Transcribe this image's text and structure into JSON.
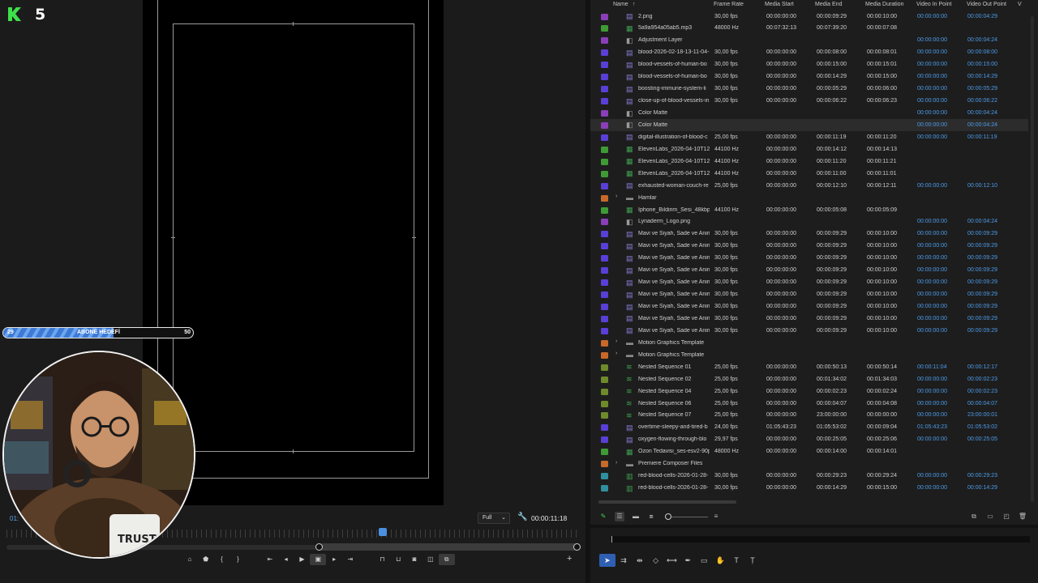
{
  "monitor": {
    "timecode_left": "01:",
    "zoom": "Full",
    "timecode_right": "00:00:11:18",
    "transport": [
      "export-frame-icon",
      "marker-icon",
      "mark-in-icon",
      "mark-out-icon",
      "go-to-in-icon",
      "step-back-icon",
      "play-icon",
      "safe-margins-icon",
      "step-forward-icon",
      "go-to-out-icon",
      "insert-icon",
      "overwrite-icon",
      "camera-icon",
      "compare-icon",
      "proxy-icon"
    ]
  },
  "overlay": {
    "logo_number": "5",
    "goal": {
      "current": "29",
      "label": "ABONE HEDEFİ",
      "target": "50",
      "progress": 0.58
    }
  },
  "project": {
    "columns": {
      "name": "Name",
      "frame_rate": "Frame Rate",
      "media_start": "Media Start",
      "media_end": "Media End",
      "media_duration": "Media Duration",
      "video_in": "Video In Point",
      "video_out": "Video Out Point",
      "extra": "V"
    },
    "label_colors": {
      "purple": "#8a3fb8",
      "violet": "#5a3fd6",
      "green": "#3f9a35",
      "orange": "#c8692a",
      "teal": "#2f8f9f",
      "olive": "#6e8a2a"
    },
    "rows": [
      {
        "label": "purple",
        "icon": "video",
        "name": "2.png",
        "fr": "30,00 fps",
        "ms": "00:00:00:00",
        "me": "00:00:09:29",
        "md": "00:00:10:00",
        "vi": "00:00:00:00",
        "vo": "00:00:04:29"
      },
      {
        "label": "green",
        "icon": "audio",
        "name": "5a9a954a05ab5.mp3",
        "fr": "48000 Hz",
        "ms": "00:07:32:13",
        "me": "00:07:39:20",
        "md": "00:00:07:08",
        "vi": "",
        "vo": ""
      },
      {
        "label": "purple",
        "icon": "adjustment",
        "name": "Adjustment Layer",
        "fr": "",
        "ms": "",
        "me": "",
        "md": "",
        "vi": "00:00:00:00",
        "vo": "00:00:04:24"
      },
      {
        "label": "violet",
        "icon": "video",
        "name": "blood-2026-02-18-13-11-04-",
        "fr": "30,00 fps",
        "ms": "00:00:00:00",
        "me": "00:00:08:00",
        "md": "00:00:08:01",
        "vi": "00:00:00:00",
        "vo": "00:00:08:00"
      },
      {
        "label": "violet",
        "icon": "video",
        "name": "blood-vessels-of-human-bo",
        "fr": "30,00 fps",
        "ms": "00:00:00:00",
        "me": "00:00:15:00",
        "md": "00:00:15:01",
        "vi": "00:00:00:00",
        "vo": "00:00:15:00"
      },
      {
        "label": "violet",
        "icon": "video",
        "name": "blood-vessels-of-human-bo",
        "fr": "30,00 fps",
        "ms": "00:00:00:00",
        "me": "00:00:14:29",
        "md": "00:00:15:00",
        "vi": "00:00:00:00",
        "vo": "00:00:14:29"
      },
      {
        "label": "violet",
        "icon": "video",
        "name": "boosting-immune-system-li",
        "fr": "30,00 fps",
        "ms": "00:00:00:00",
        "me": "00:00:05:29",
        "md": "00:00:06:00",
        "vi": "00:00:00:00",
        "vo": "00:00:05:29"
      },
      {
        "label": "violet",
        "icon": "video",
        "name": "close-up-of-blood-vessels-in",
        "fr": "30,00 fps",
        "ms": "00:00:00:00",
        "me": "00:00:06:22",
        "md": "00:00:06:23",
        "vi": "00:00:00:00",
        "vo": "00:00:06:22"
      },
      {
        "label": "purple",
        "icon": "adjustment",
        "name": "Color Matte",
        "fr": "",
        "ms": "",
        "me": "",
        "md": "",
        "vi": "00:00:00:00",
        "vo": "00:00:04:24"
      },
      {
        "label": "purple",
        "icon": "adjustment",
        "name": "Color Matte",
        "fr": "",
        "ms": "",
        "me": "",
        "md": "",
        "vi": "00:00:00:00",
        "vo": "00:00:04:24",
        "selected": true
      },
      {
        "label": "violet",
        "icon": "video",
        "name": "digital-illustration-of-blood-c",
        "fr": "25,00 fps",
        "ms": "00:00:00:00",
        "me": "00:00:11:19",
        "md": "00:00:11:20",
        "vi": "00:00:00:00",
        "vo": "00:00:11:19"
      },
      {
        "label": "green",
        "icon": "audio",
        "name": "ElevenLabs_2026-04-10T12",
        "fr": "44100 Hz",
        "ms": "00:00:00:00",
        "me": "00:00:14:12",
        "md": "00:00:14:13",
        "vi": "",
        "vo": ""
      },
      {
        "label": "green",
        "icon": "audio",
        "name": "ElevenLabs_2026-04-10T12",
        "fr": "44100 Hz",
        "ms": "00:00:00:00",
        "me": "00:00:11:20",
        "md": "00:00:11:21",
        "vi": "",
        "vo": ""
      },
      {
        "label": "green",
        "icon": "audio",
        "name": "ElevenLabs_2026-04-10T12",
        "fr": "44100 Hz",
        "ms": "00:00:00:00",
        "me": "00:00:11:00",
        "md": "00:00:11:01",
        "vi": "",
        "vo": ""
      },
      {
        "label": "violet",
        "icon": "video",
        "name": "exhausted-woman-couch-re",
        "fr": "25,00 fps",
        "ms": "00:00:00:00",
        "me": "00:00:12:10",
        "md": "00:00:12:11",
        "vi": "00:00:00:00",
        "vo": "00:00:12:10"
      },
      {
        "label": "orange",
        "icon": "folder",
        "name": "Hamlar",
        "fr": "",
        "ms": "",
        "me": "",
        "md": "",
        "vi": "",
        "vo": "",
        "twirl": true
      },
      {
        "label": "green",
        "icon": "audio",
        "name": "Iphone_Bildirim_Sesi_48kbp",
        "fr": "44100 Hz",
        "ms": "00:00:00:00",
        "me": "00:00:05:08",
        "md": "00:00:05:09",
        "vi": "",
        "vo": ""
      },
      {
        "label": "purple",
        "icon": "adjustment",
        "name": "Lynaderm_Logo.png",
        "fr": "",
        "ms": "",
        "me": "",
        "md": "",
        "vi": "00:00:00:00",
        "vo": "00:00:04:24"
      },
      {
        "label": "violet",
        "icon": "video",
        "name": "Mavi ve Siyah, Sade ve Anim",
        "fr": "30,00 fps",
        "ms": "00:00:00:00",
        "me": "00:00:09:29",
        "md": "00:00:10:00",
        "vi": "00:00:00:00",
        "vo": "00:00:09:29"
      },
      {
        "label": "violet",
        "icon": "video",
        "name": "Mavi ve Siyah, Sade ve Anim",
        "fr": "30,00 fps",
        "ms": "00:00:00:00",
        "me": "00:00:09:29",
        "md": "00:00:10:00",
        "vi": "00:00:00:00",
        "vo": "00:00:09:29"
      },
      {
        "label": "violet",
        "icon": "video",
        "name": "Mavi ve Siyah, Sade ve Anim",
        "fr": "30,00 fps",
        "ms": "00:00:00:00",
        "me": "00:00:09:29",
        "md": "00:00:10:00",
        "vi": "00:00:00:00",
        "vo": "00:00:09:29"
      },
      {
        "label": "violet",
        "icon": "video",
        "name": "Mavi ve Siyah, Sade ve Anim",
        "fr": "30,00 fps",
        "ms": "00:00:00:00",
        "me": "00:00:09:29",
        "md": "00:00:10:00",
        "vi": "00:00:00:00",
        "vo": "00:00:09:29"
      },
      {
        "label": "violet",
        "icon": "video",
        "name": "Mavi ve Siyah, Sade ve Anim",
        "fr": "30,00 fps",
        "ms": "00:00:00:00",
        "me": "00:00:09:29",
        "md": "00:00:10:00",
        "vi": "00:00:00:00",
        "vo": "00:00:09:29"
      },
      {
        "label": "violet",
        "icon": "video",
        "name": "Mavi ve Siyah, Sade ve Anim",
        "fr": "30,00 fps",
        "ms": "00:00:00:00",
        "me": "00:00:09:29",
        "md": "00:00:10:00",
        "vi": "00:00:00:00",
        "vo": "00:00:09:29"
      },
      {
        "label": "violet",
        "icon": "video",
        "name": "Mavi ve Siyah, Sade ve Anim",
        "fr": "30,00 fps",
        "ms": "00:00:00:00",
        "me": "00:00:09:29",
        "md": "00:00:10:00",
        "vi": "00:00:00:00",
        "vo": "00:00:09:29"
      },
      {
        "label": "violet",
        "icon": "video",
        "name": "Mavi ve Siyah, Sade ve Anim",
        "fr": "30,00 fps",
        "ms": "00:00:00:00",
        "me": "00:00:09:29",
        "md": "00:00:10:00",
        "vi": "00:00:00:00",
        "vo": "00:00:09:29"
      },
      {
        "label": "violet",
        "icon": "video",
        "name": "Mavi ve Siyah, Sade ve Anim",
        "fr": "30,00 fps",
        "ms": "00:00:00:00",
        "me": "00:00:09:29",
        "md": "00:00:10:00",
        "vi": "00:00:00:00",
        "vo": "00:00:09:29"
      },
      {
        "label": "orange",
        "icon": "folder",
        "name": "Motion Graphics Template",
        "fr": "",
        "ms": "",
        "me": "",
        "md": "",
        "vi": "",
        "vo": "",
        "twirl": true
      },
      {
        "label": "orange",
        "icon": "folder",
        "name": "Motion Graphics Template",
        "fr": "",
        "ms": "",
        "me": "",
        "md": "",
        "vi": "",
        "vo": "",
        "twirl": true
      },
      {
        "label": "olive",
        "icon": "sequence",
        "name": "Nested Sequence 01",
        "fr": "25,00 fps",
        "ms": "00:00:00:00",
        "me": "00:00:50:13",
        "md": "00:00:50:14",
        "vi": "00:00:11:04",
        "vo": "00:00:12:17"
      },
      {
        "label": "olive",
        "icon": "sequence",
        "name": "Nested Sequence 02",
        "fr": "25,00 fps",
        "ms": "00:00:00:00",
        "me": "00:01:34:02",
        "md": "00:01:34:03",
        "vi": "00:00:00:00",
        "vo": "00:00:02:23"
      },
      {
        "label": "olive",
        "icon": "sequence",
        "name": "Nested Sequence 04",
        "fr": "25,00 fps",
        "ms": "00:00:00:00",
        "me": "00:00:02:23",
        "md": "00:00:02:24",
        "vi": "00:00:00:00",
        "vo": "00:00:02:23"
      },
      {
        "label": "olive",
        "icon": "sequence",
        "name": "Nested Sequence 06",
        "fr": "25,00 fps",
        "ms": "00:00:00:00",
        "me": "00:00:04:07",
        "md": "00:00:04:08",
        "vi": "00:00:00:00",
        "vo": "00:00:04:07"
      },
      {
        "label": "olive",
        "icon": "sequence",
        "name": "Nested Sequence 07",
        "fr": "25,00 fps",
        "ms": "00:00:00:00",
        "me": "23:00:00:00",
        "md": "00:00:00:00",
        "vi": "00:00:00:00",
        "vo": "23:00:00:01"
      },
      {
        "label": "violet",
        "icon": "video",
        "name": "overtime-sleepy-and-tired-b",
        "fr": "24,00 fps",
        "ms": "01:05:43:23",
        "me": "01:05:53:02",
        "md": "00:00:09:04",
        "vi": "01:05:43:23",
        "vo": "01:05:53:02"
      },
      {
        "label": "violet",
        "icon": "video",
        "name": "oxygen-flowing-through-blo",
        "fr": "29,97 fps",
        "ms": "00:00:00:00",
        "me": "00:00:25:05",
        "md": "00:00:25:06",
        "vi": "00:00:00:00",
        "vo": "00:00:25:05"
      },
      {
        "label": "green",
        "icon": "audio",
        "name": "Ozon Tedavisi_ses-esv2-90p-",
        "fr": "48000 Hz",
        "ms": "00:00:00:00",
        "me": "00:00:14:00",
        "md": "00:00:14:01",
        "vi": "",
        "vo": ""
      },
      {
        "label": "orange",
        "icon": "folder",
        "name": "Premiere Composer Files",
        "fr": "",
        "ms": "",
        "me": "",
        "md": "",
        "vi": "",
        "vo": "",
        "twirl": true
      },
      {
        "label": "teal",
        "icon": "av",
        "name": "red-blood-cells-2026-01-28-",
        "fr": "30,00 fps",
        "ms": "00:00:00:00",
        "me": "00:00:29:23",
        "md": "00:00:29:24",
        "vi": "00:00:00:00",
        "vo": "00:00:29:23"
      },
      {
        "label": "teal",
        "icon": "av",
        "name": "red-blood-cells-2026-01-28-",
        "fr": "30,00 fps",
        "ms": "00:00:00:00",
        "me": "00:00:14:29",
        "md": "00:00:15:00",
        "vi": "00:00:00:00",
        "vo": "00:00:14:29"
      }
    ],
    "toolbar": [
      "pencil-icon",
      "list-view-icon",
      "icon-view-icon",
      "freeform-view-icon",
      "zoom-icon",
      "sort-icon",
      "automate-icon",
      "find-icon",
      "new-bin-icon",
      "new-item-icon",
      "trash-icon"
    ]
  },
  "tools": [
    "selection-icon",
    "track-select-icon",
    "ripple-edit-icon",
    "razor-icon",
    "slip-icon",
    "pen-icon",
    "rectangle-icon",
    "hand-icon",
    "type-icon",
    "captions-icon"
  ]
}
